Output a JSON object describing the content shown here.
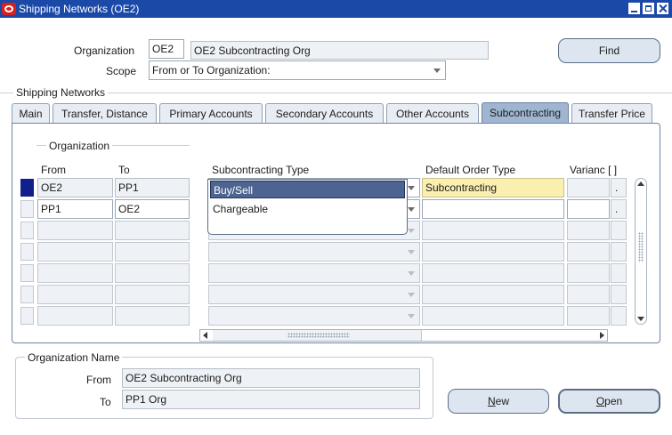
{
  "window": {
    "title": "Shipping Networks (OE2)"
  },
  "header": {
    "organization_label": "Organization",
    "organization_code": "OE2",
    "organization_name": "OE2 Subcontracting Org",
    "scope_label": "Scope",
    "scope_value": "From or To Organization:",
    "find_label": "Find"
  },
  "section_title": "Shipping Networks",
  "tabs": [
    {
      "label": "Main",
      "active": false
    },
    {
      "label": "Transfer, Distance",
      "active": false
    },
    {
      "label": "Primary Accounts",
      "active": false
    },
    {
      "label": "Secondary Accounts",
      "active": false
    },
    {
      "label": "Other Accounts",
      "active": false
    },
    {
      "label": "Subcontracting",
      "active": true
    },
    {
      "label": "Transfer Price",
      "active": false
    }
  ],
  "grid": {
    "group_label": "Organization",
    "columns": {
      "from": "From",
      "to": "To",
      "subcontracting_type": "Subcontracting Type",
      "default_order_type": "Default Order Type",
      "variance": "Varianc [ ]"
    },
    "rows": [
      {
        "from": "OE2",
        "to": "PP1",
        "subcontracting_type": "",
        "default_order_type": "Subcontracting"
      },
      {
        "from": "PP1",
        "to": "OE2",
        "subcontracting_type": "",
        "default_order_type": ""
      },
      {
        "from": "",
        "to": "",
        "subcontracting_type": "",
        "default_order_type": ""
      },
      {
        "from": "",
        "to": "",
        "subcontracting_type": "",
        "default_order_type": ""
      },
      {
        "from": "",
        "to": "",
        "subcontracting_type": "",
        "default_order_type": ""
      },
      {
        "from": "",
        "to": "",
        "subcontracting_type": "",
        "default_order_type": ""
      },
      {
        "from": "",
        "to": "",
        "subcontracting_type": "",
        "default_order_type": ""
      }
    ],
    "dropdown_options": [
      "Buy/Sell",
      "Chargeable"
    ],
    "dropdown_selected": "Buy/Sell",
    "dots": [
      "."
    ]
  },
  "org_name": {
    "title": "Organization Name",
    "from_label": "From",
    "from_value": "OE2 Subcontracting Org",
    "to_label": "To",
    "to_value": "PP1 Org"
  },
  "buttons": {
    "new_label": "New",
    "new_mnemonic": "N",
    "new_rest": "ew",
    "open_label": "Open",
    "open_mnemonic": "O",
    "open_rest": "pen"
  },
  "colors": {
    "titlebar": "#1b49a8",
    "active_tab": "#9fb5d0",
    "required_field": "#fbefb0",
    "selected_option": "#4e6490",
    "current_row": "#0f1f8c"
  }
}
